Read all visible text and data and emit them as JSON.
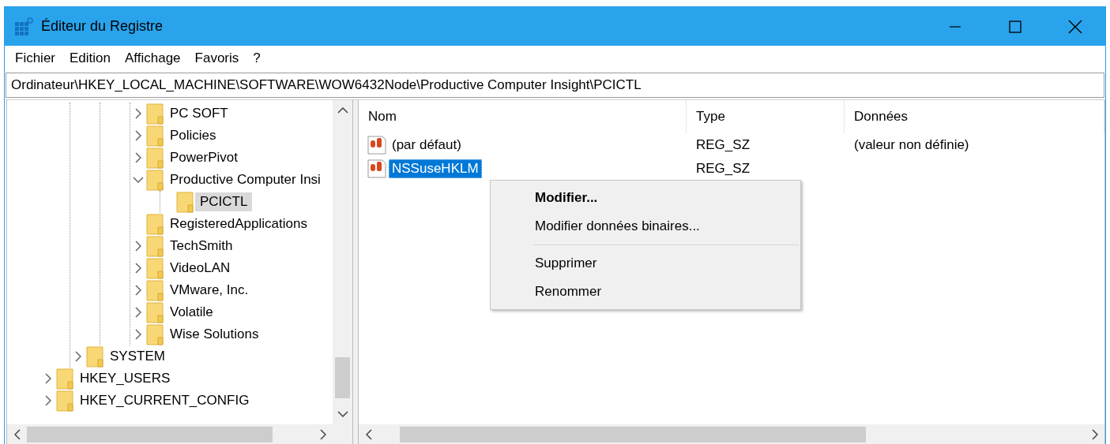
{
  "window": {
    "title": "Éditeur du Registre"
  },
  "menu_bar": [
    {
      "label": "Fichier"
    },
    {
      "label": "Edition"
    },
    {
      "label": "Affichage"
    },
    {
      "label": "Favoris"
    },
    {
      "label": "?"
    }
  ],
  "address_bar": {
    "value": "Ordinateur\\HKEY_LOCAL_MACHINE\\SOFTWARE\\WOW6432Node\\Productive Computer Insight\\PCICTL"
  },
  "tree": {
    "items": [
      {
        "children": [
          {
            "children": [
              {
                "children": [
                  {
                    "label": "PC SOFT",
                    "expanded": false,
                    "leaf": false,
                    "selected": false
                  },
                  {
                    "label": "Policies",
                    "expanded": false,
                    "leaf": false,
                    "selected": false
                  },
                  {
                    "label": "PowerPivot",
                    "expanded": false,
                    "leaf": false,
                    "selected": false
                  },
                  {
                    "label": "Productive Computer Insi",
                    "expanded": true,
                    "leaf": false,
                    "selected": false,
                    "children": [
                      {
                        "label": "PCICTL",
                        "leaf": true,
                        "selected": true
                      }
                    ]
                  },
                  {
                    "label": "RegisteredApplications",
                    "leaf": true,
                    "selected": false
                  },
                  {
                    "label": "TechSmith",
                    "expanded": false,
                    "leaf": false,
                    "selected": false
                  },
                  {
                    "label": "VideoLAN",
                    "expanded": false,
                    "leaf": false,
                    "selected": false
                  },
                  {
                    "label": "VMware, Inc.",
                    "expanded": false,
                    "leaf": false,
                    "selected": false
                  },
                  {
                    "label": "Volatile",
                    "expanded": false,
                    "leaf": false,
                    "selected": false
                  },
                  {
                    "label": "Wise Solutions",
                    "expanded": false,
                    "leaf": false,
                    "selected": false
                  }
                ]
              }
            ]
          },
          {
            "label": "SYSTEM",
            "expanded": false,
            "leaf": false,
            "selected": false
          }
        ]
      },
      {
        "label": "HKEY_USERS",
        "expanded": false,
        "leaf": false,
        "selected": false
      },
      {
        "label": "HKEY_CURRENT_CONFIG",
        "expanded": false,
        "leaf": false,
        "selected": false
      }
    ]
  },
  "values_list": {
    "columns": [
      "Nom",
      "Type",
      "Données"
    ],
    "rows": [
      {
        "name": "(par défaut)",
        "type": "REG_SZ",
        "data": "(valeur non définie)",
        "selected": false
      },
      {
        "name": "NSSuseHKLM",
        "type": "REG_SZ",
        "selected": true
      }
    ]
  },
  "context_menu": {
    "items": [
      {
        "kind": "item",
        "label": "Modifier...",
        "default": true
      },
      {
        "kind": "item",
        "label": "Modifier données binaires...",
        "default": false
      },
      {
        "kind": "separator"
      },
      {
        "kind": "item",
        "label": "Supprimer",
        "default": false
      },
      {
        "kind": "item",
        "label": "Renommer",
        "default": false
      }
    ]
  }
}
